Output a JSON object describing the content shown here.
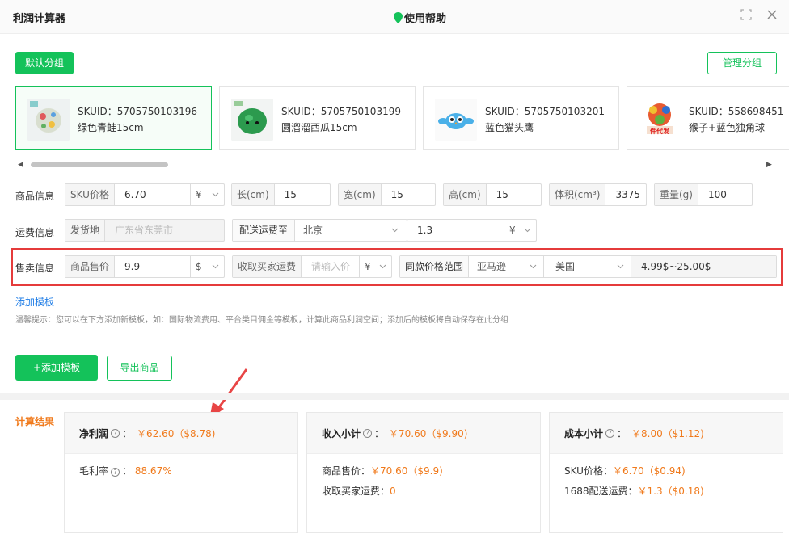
{
  "header": {
    "title": "利润计算器",
    "help_label": "使用帮助"
  },
  "groups": {
    "default_label": "默认分组",
    "manage_label": "管理分组"
  },
  "products": [
    {
      "sku": "SKUID：5705750103196",
      "name": "绿色青蛙15cm",
      "selected": true
    },
    {
      "sku": "SKUID：5705750103199",
      "name": "圆溜溜西瓜15cm",
      "selected": false
    },
    {
      "sku": "SKUID：5705750103201",
      "name": "蓝色猫头鹰",
      "selected": false
    },
    {
      "sku": "SKUID：558698451",
      "name": "猴子+蓝色独角球",
      "selected": false
    }
  ],
  "product_info": {
    "label": "商品信息",
    "sku_price": {
      "label": "SKU价格",
      "value": "6.70",
      "currency": "¥"
    },
    "length": {
      "label": "长(cm)",
      "value": "15"
    },
    "width": {
      "label": "宽(cm)",
      "value": "15"
    },
    "height": {
      "label": "高(cm)",
      "value": "15"
    },
    "volume": {
      "label": "体积(cm³)",
      "value": "3375"
    },
    "weight": {
      "label": "重量(g)",
      "value": "100"
    }
  },
  "shipping_info": {
    "label": "运费信息",
    "origin": {
      "label": "发货地",
      "placeholder": "广东省东莞市"
    },
    "dest": {
      "label": "配送运费至",
      "value": "北京"
    },
    "fee": {
      "value": "1.3",
      "currency": "¥"
    }
  },
  "sales_info": {
    "label": "售卖信息",
    "price": {
      "label": "商品售价",
      "value": "9.9",
      "currency": "$"
    },
    "buyer_shipping": {
      "label": "收取买家运费",
      "placeholder": "请输入价",
      "currency": "¥"
    },
    "range": {
      "label": "同款价格范围",
      "platform": "亚马逊",
      "country": "美国",
      "value": "4.99$~25.00$"
    }
  },
  "template": {
    "add_link": "添加模板",
    "tip": "温馨提示：您可以在下方添加新模板，如：国际物流费用、平台类目佣金等模板，计算此商品利润空间；添加后的模板将自动保存在此分组",
    "add_button": "+添加模板",
    "export_button": "导出商品"
  },
  "results": {
    "label": "计算结果",
    "net_profit": {
      "title": "净利润",
      "value": "￥62.60（$8.78)",
      "margin_label": "毛利率",
      "margin_value": "88.67%"
    },
    "income": {
      "title": "收入小计",
      "value": "￥70.60（$9.90)",
      "sale_label": "商品售价：",
      "sale_value": "￥70.60（$9.9)",
      "ship_label": "收取买家运费：",
      "ship_value": "0"
    },
    "cost": {
      "title": "成本小计",
      "value": "￥8.00（$1.12)",
      "sku_label": "SKU价格：",
      "sku_value": "￥6.70（$0.94)",
      "ship_label": "1688配送运费：",
      "ship_value": "￥1.3（$0.18)"
    }
  },
  "colors": {
    "accent": "#14c25a",
    "highlight": "#e53b3b",
    "orange": "#f07a1c",
    "link": "#1e7ce6"
  },
  "icons": [
    "location-pin-icon",
    "fullscreen-icon",
    "close-icon",
    "question-icon",
    "chevron-down-icon",
    "scroll-left-icon",
    "scroll-right-icon",
    "annotation-arrow"
  ]
}
